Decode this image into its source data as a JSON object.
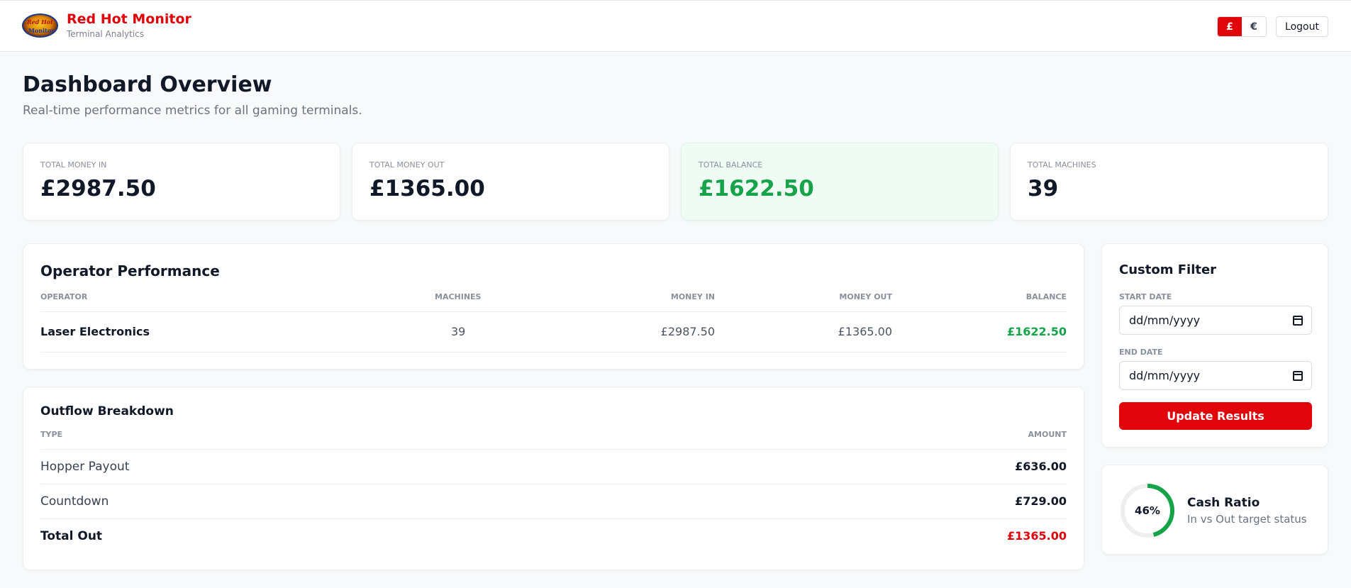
{
  "header": {
    "title": "Red Hot Monitor",
    "subtitle": "Terminal Analytics",
    "logo_text_1": "Red Hot",
    "logo_text_2": "Monitor",
    "currencies": [
      "£",
      "€"
    ],
    "active_currency": "£",
    "logout_label": "Logout"
  },
  "page": {
    "title": "Dashboard Overview",
    "subtitle": "Real-time performance metrics for all gaming terminals."
  },
  "stats": [
    {
      "label": "Total Money In",
      "value": "£2987.50"
    },
    {
      "label": "Total Money Out",
      "value": "£1365.00"
    },
    {
      "label": "Total Balance",
      "value": "£1622.50"
    },
    {
      "label": "Total Machines",
      "value": "39"
    }
  ],
  "operator_performance": {
    "title": "Operator Performance",
    "columns": [
      "Operator",
      "Machines",
      "Money In",
      "Money Out",
      "Balance"
    ],
    "rows": [
      {
        "operator": "Laser Electronics",
        "machines": "39",
        "money_in": "£2987.50",
        "money_out": "£1365.00",
        "balance": "£1622.50"
      }
    ]
  },
  "outflow": {
    "title": "Outflow Breakdown",
    "columns": [
      "Type",
      "Amount"
    ],
    "rows": [
      {
        "type": "Hopper Payout",
        "amount": "£636.00"
      },
      {
        "type": "Countdown",
        "amount": "£729.00"
      }
    ],
    "total": {
      "type": "Total Out",
      "amount": "£1365.00"
    }
  },
  "filter": {
    "title": "Custom Filter",
    "start_label": "Start Date",
    "start_value": "dd/mm/yyyy",
    "end_label": "End Date",
    "end_value": "dd/mm/yyyy",
    "button_label": "Update Results"
  },
  "cash_ratio": {
    "percent_text": "46%",
    "fraction": 0.46,
    "title": "Cash Ratio",
    "subtitle": "In vs Out target status"
  },
  "colors": {
    "brand_red": "#e0040b",
    "positive_green": "#16a34a",
    "balance_card_bg": "#effcf3"
  }
}
